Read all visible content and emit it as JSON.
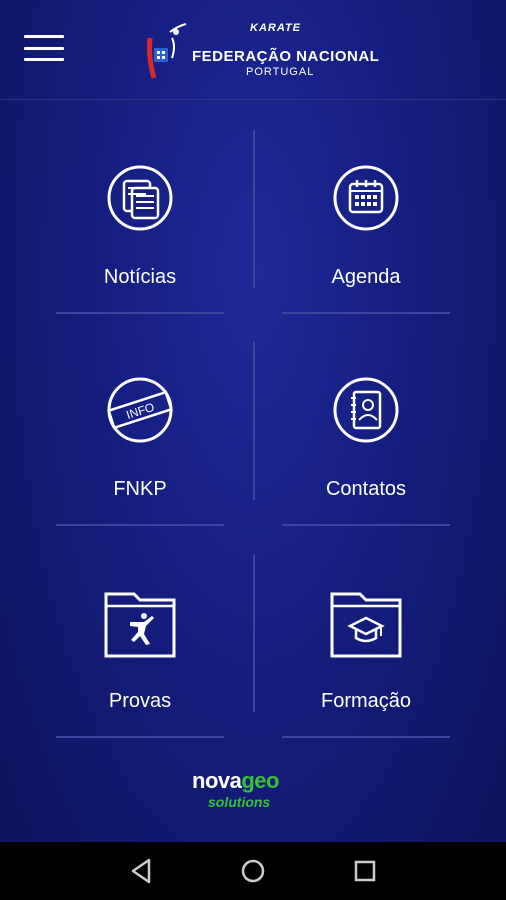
{
  "header": {
    "menu_icon": "hamburger-menu-icon",
    "logo": {
      "karate": "KARATE",
      "federacao": "FEDERAÇÃO NACIONAL",
      "portugal": "PORTUGAL"
    }
  },
  "menu": {
    "items": [
      {
        "label": "Notícias",
        "icon": "news-icon"
      },
      {
        "label": "Agenda",
        "icon": "calendar-icon"
      },
      {
        "label": "FNKP",
        "icon": "info-icon"
      },
      {
        "label": "Contatos",
        "icon": "contacts-icon"
      },
      {
        "label": "Provas",
        "icon": "folder-karate-icon"
      },
      {
        "label": "Formação",
        "icon": "folder-graduation-icon"
      }
    ],
    "icon_info_text": "INFO"
  },
  "footer": {
    "brand_nova": "nova",
    "brand_geo": "geo",
    "brand_solutions": "solutions"
  },
  "navbar": {
    "back_icon": "back-icon",
    "home_icon": "home-icon",
    "recents_icon": "recents-icon"
  },
  "colors": {
    "background": "#141d7e",
    "accent_green": "#36c23b",
    "divider": "#3b45a0"
  }
}
